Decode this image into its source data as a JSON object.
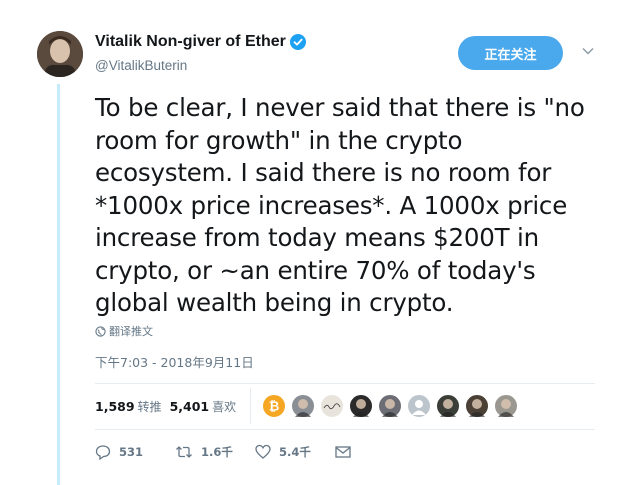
{
  "author": {
    "display_name": "Vitalik Non-giver of Ether",
    "handle": "@VitalikButerin",
    "verified": true
  },
  "follow_button": {
    "label": "正在关注"
  },
  "tweet": {
    "lines": [
      "To be clear, I never said that there is \"no",
      "room for growth\" in the crypto",
      "ecosystem. I said there is no room for",
      "*1000x price increases*. A 1000x price",
      "increase from today means $200T in",
      "crypto, or ~an entire 70% of today's",
      "global wealth being in crypto."
    ],
    "translate_label": "翻译推文",
    "timestamp": "下午7:03 - 2018年9月11日"
  },
  "stats": {
    "retweets_count": "1,589",
    "retweets_label": "转推",
    "likes_count": "5,401",
    "likes_label": "喜欢"
  },
  "liker_avatars": [
    {
      "color": "#f5a623",
      "icon": "bitcoin-coin"
    },
    {
      "color": "#8a8f96",
      "icon": "person"
    },
    {
      "color": "#e8e4dc",
      "icon": "signature"
    },
    {
      "color": "#2b2b2b",
      "icon": "person"
    },
    {
      "color": "#6d6e75",
      "icon": "person"
    },
    {
      "color": "#bcc4cc",
      "icon": "default-person"
    },
    {
      "color": "#3a3d38",
      "icon": "person"
    },
    {
      "color": "#4a4036",
      "icon": "person"
    },
    {
      "color": "#9a9690",
      "icon": "person"
    }
  ],
  "actions": {
    "reply_count": "531",
    "retweet_count": "1.6千",
    "like_count": "5.4千"
  },
  "colors": {
    "accent": "#4aa8ec",
    "thread_line": "#c7ecf9",
    "secondary_text": "#657786"
  }
}
